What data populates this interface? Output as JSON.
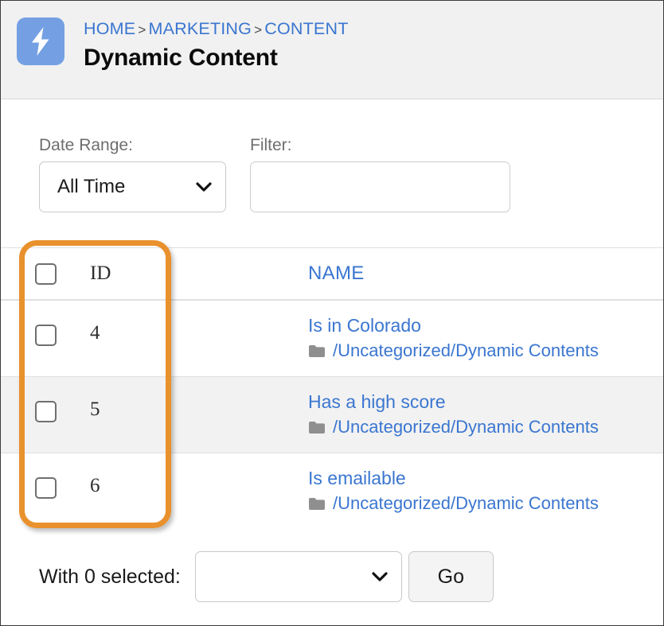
{
  "header": {
    "app_icon": "lightning-bolt-icon",
    "app_icon_color": "#74a0e3",
    "breadcrumb": [
      {
        "label": "HOME"
      },
      {
        "label": "MARKETING"
      },
      {
        "label": "CONTENT"
      }
    ],
    "breadcrumb_separator": ">",
    "title": "Dynamic Content",
    "link_color": "#3a76d0"
  },
  "filters": {
    "date_range": {
      "label": "Date Range:",
      "value": "All Time",
      "icon": "chevron-down-icon"
    },
    "filter": {
      "label": "Filter:",
      "value": "",
      "placeholder": ""
    }
  },
  "table": {
    "columns": {
      "checkbox": "",
      "id": "ID",
      "name": "NAME"
    },
    "rows": [
      {
        "id": "4",
        "name": "Is in Colorado",
        "path": "/Uncategorized/Dynamic Contents",
        "path_icon": "folder-icon",
        "checked": false,
        "striped": false
      },
      {
        "id": "5",
        "name": "Has a high score",
        "path": "/Uncategorized/Dynamic Contents",
        "path_icon": "folder-icon",
        "checked": false,
        "striped": true
      },
      {
        "id": "6",
        "name": "Is emailable",
        "path": "/Uncategorized/Dynamic Contents",
        "path_icon": "folder-icon",
        "checked": false,
        "striped": false
      }
    ]
  },
  "footer": {
    "label": "With 0 selected:",
    "selected_count": 0,
    "action_select_value": "",
    "action_select_icon": "chevron-down-icon",
    "go_label": "Go"
  },
  "annotation": {
    "type": "highlight-rectangle",
    "color": "#e8912d",
    "target": "id-column-with-checkboxes"
  }
}
